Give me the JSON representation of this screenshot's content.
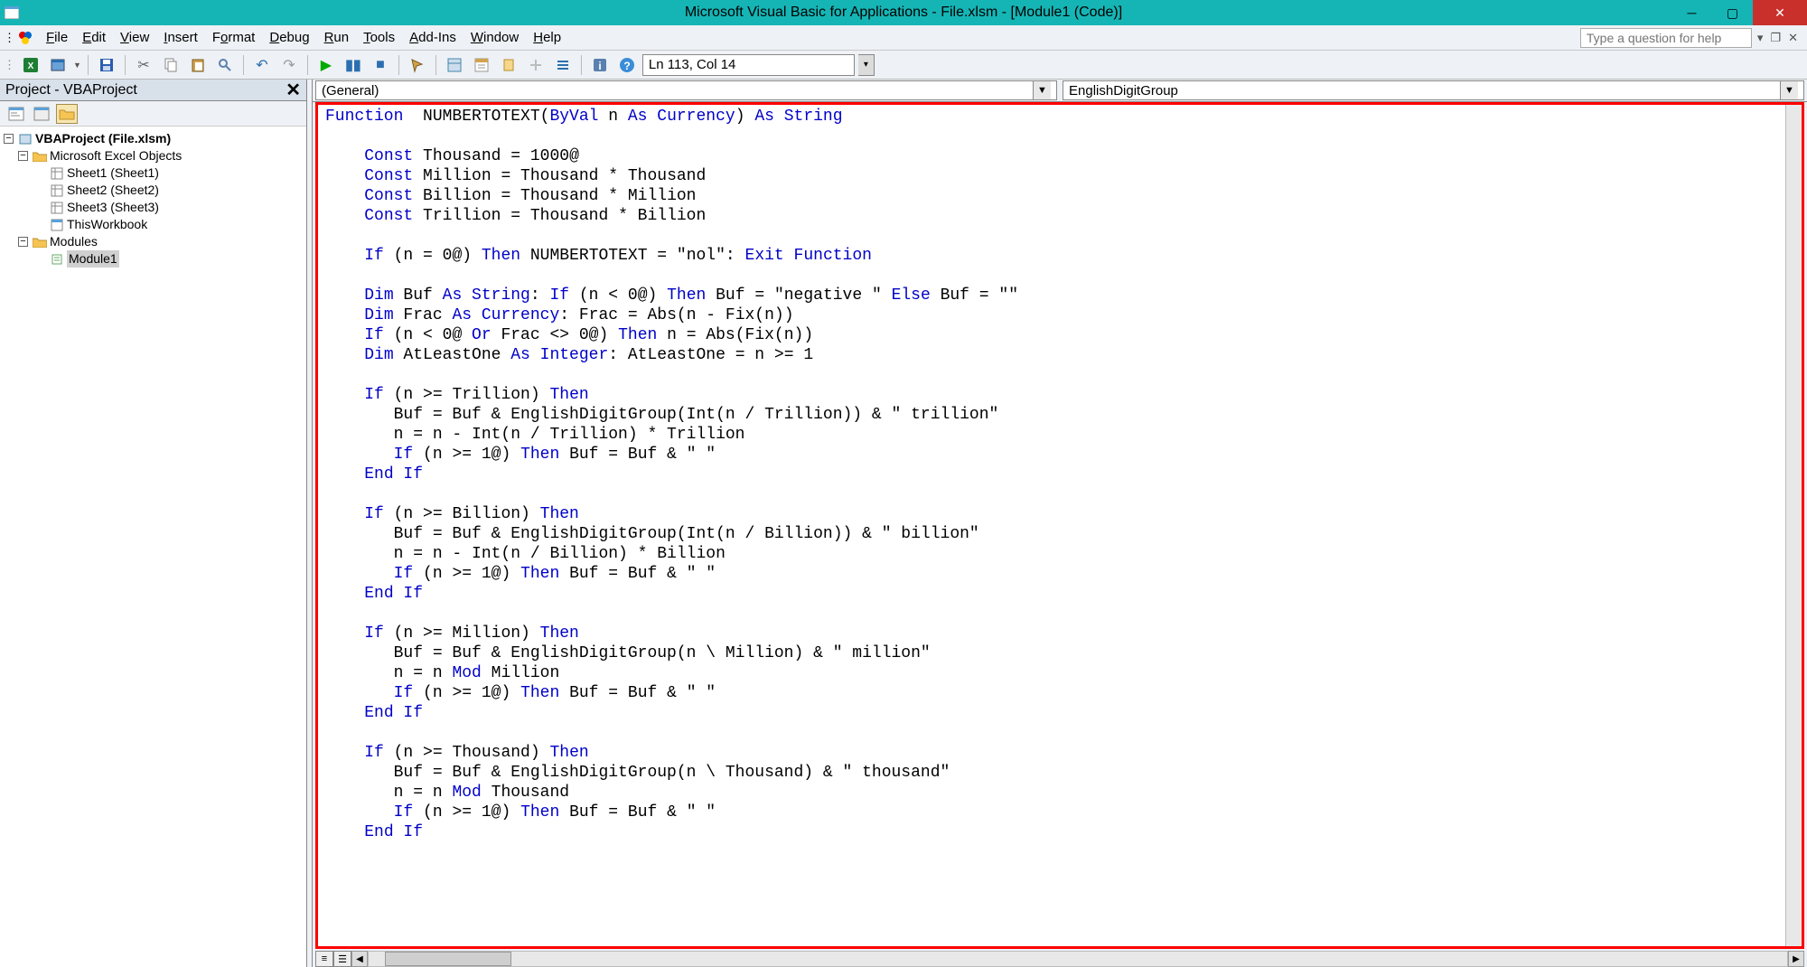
{
  "window": {
    "title": "Microsoft Visual Basic for Applications - File.xlsm - [Module1 (Code)]"
  },
  "menus": {
    "file": "File",
    "edit": "Edit",
    "view": "View",
    "insert": "Insert",
    "format": "Format",
    "debug": "Debug",
    "run": "Run",
    "tools": "Tools",
    "addins": "Add-Ins",
    "window": "Window",
    "help": "Help"
  },
  "help_search": {
    "placeholder": "Type a question for help"
  },
  "toolbar": {
    "position": "Ln 113, Col 14"
  },
  "project": {
    "title": "Project - VBAProject",
    "root": "VBAProject (File.xlsm)",
    "excel_objects": "Microsoft Excel Objects",
    "sheet1": "Sheet1 (Sheet1)",
    "sheet2": "Sheet2 (Sheet2)",
    "sheet3": "Sheet3 (Sheet3)",
    "thiswb": "ThisWorkbook",
    "modules": "Modules",
    "module1": "Module1"
  },
  "object_combo": "(General)",
  "proc_combo": "EnglishDigitGroup",
  "code": {
    "tokens": [
      [
        [
          "kw",
          "Function"
        ],
        [
          "",
          "  NUMBERTOTEXT("
        ],
        [
          "kw",
          "ByVal"
        ],
        [
          "",
          " n "
        ],
        [
          "kw",
          "As Currency"
        ],
        [
          "",
          ") "
        ],
        [
          "kw",
          "As String"
        ]
      ],
      [
        [
          "",
          ""
        ]
      ],
      [
        [
          "",
          "    "
        ],
        [
          "kw",
          "Const"
        ],
        [
          "",
          " Thousand = 1000@"
        ]
      ],
      [
        [
          "",
          "    "
        ],
        [
          "kw",
          "Const"
        ],
        [
          "",
          " Million = Thousand * Thousand"
        ]
      ],
      [
        [
          "",
          "    "
        ],
        [
          "kw",
          "Const"
        ],
        [
          "",
          " Billion = Thousand * Million"
        ]
      ],
      [
        [
          "",
          "    "
        ],
        [
          "kw",
          "Const"
        ],
        [
          "",
          " Trillion = Thousand * Billion"
        ]
      ],
      [
        [
          "",
          ""
        ]
      ],
      [
        [
          "",
          "    "
        ],
        [
          "kw",
          "If"
        ],
        [
          "",
          " (n = 0@) "
        ],
        [
          "kw",
          "Then"
        ],
        [
          "",
          " NUMBERTOTEXT = \"nol\": "
        ],
        [
          "kw",
          "Exit Function"
        ]
      ],
      [
        [
          "",
          ""
        ]
      ],
      [
        [
          "",
          "    "
        ],
        [
          "kw",
          "Dim"
        ],
        [
          "",
          " Buf "
        ],
        [
          "kw",
          "As String"
        ],
        [
          "",
          ": "
        ],
        [
          "kw",
          "If"
        ],
        [
          "",
          " (n < 0@) "
        ],
        [
          "kw",
          "Then"
        ],
        [
          "",
          " Buf = \"negative \" "
        ],
        [
          "kw",
          "Else"
        ],
        [
          "",
          " Buf = \"\""
        ]
      ],
      [
        [
          "",
          "    "
        ],
        [
          "kw",
          "Dim"
        ],
        [
          "",
          " Frac "
        ],
        [
          "kw",
          "As Currency"
        ],
        [
          "",
          ": Frac = Abs(n - Fix(n))"
        ]
      ],
      [
        [
          "",
          "    "
        ],
        [
          "kw",
          "If"
        ],
        [
          "",
          " (n < 0@ "
        ],
        [
          "kw",
          "Or"
        ],
        [
          "",
          " Frac <> 0@) "
        ],
        [
          "kw",
          "Then"
        ],
        [
          "",
          " n = Abs(Fix(n))"
        ]
      ],
      [
        [
          "",
          "    "
        ],
        [
          "kw",
          "Dim"
        ],
        [
          "",
          " AtLeastOne "
        ],
        [
          "kw",
          "As Integer"
        ],
        [
          "",
          ": AtLeastOne = n >= 1"
        ]
      ],
      [
        [
          "",
          ""
        ]
      ],
      [
        [
          "",
          "    "
        ],
        [
          "kw",
          "If"
        ],
        [
          "",
          " (n >= Trillion) "
        ],
        [
          "kw",
          "Then"
        ]
      ],
      [
        [
          "",
          "       Buf = Buf & EnglishDigitGroup(Int(n / Trillion)) & \" trillion\""
        ]
      ],
      [
        [
          "",
          "       n = n - Int(n / Trillion) * Trillion"
        ]
      ],
      [
        [
          "",
          "       "
        ],
        [
          "kw",
          "If"
        ],
        [
          "",
          " (n >= 1@) "
        ],
        [
          "kw",
          "Then"
        ],
        [
          "",
          " Buf = Buf & \" \""
        ]
      ],
      [
        [
          "",
          "    "
        ],
        [
          "kw",
          "End If"
        ]
      ],
      [
        [
          "",
          ""
        ]
      ],
      [
        [
          "",
          "    "
        ],
        [
          "kw",
          "If"
        ],
        [
          "",
          " (n >= Billion) "
        ],
        [
          "kw",
          "Then"
        ]
      ],
      [
        [
          "",
          "       Buf = Buf & EnglishDigitGroup(Int(n / Billion)) & \" billion\""
        ]
      ],
      [
        [
          "",
          "       n = n - Int(n / Billion) * Billion"
        ]
      ],
      [
        [
          "",
          "       "
        ],
        [
          "kw",
          "If"
        ],
        [
          "",
          " (n >= 1@) "
        ],
        [
          "kw",
          "Then"
        ],
        [
          "",
          " Buf = Buf & \" \""
        ]
      ],
      [
        [
          "",
          "    "
        ],
        [
          "kw",
          "End If"
        ]
      ],
      [
        [
          "",
          ""
        ]
      ],
      [
        [
          "",
          "    "
        ],
        [
          "kw",
          "If"
        ],
        [
          "",
          " (n >= Million) "
        ],
        [
          "kw",
          "Then"
        ]
      ],
      [
        [
          "",
          "       Buf = Buf & EnglishDigitGroup(n \\ Million) & \" million\""
        ]
      ],
      [
        [
          "",
          "       n = n "
        ],
        [
          "kw",
          "Mod"
        ],
        [
          "",
          " Million"
        ]
      ],
      [
        [
          "",
          "       "
        ],
        [
          "kw",
          "If"
        ],
        [
          "",
          " (n >= 1@) "
        ],
        [
          "kw",
          "Then"
        ],
        [
          "",
          " Buf = Buf & \" \""
        ]
      ],
      [
        [
          "",
          "    "
        ],
        [
          "kw",
          "End If"
        ]
      ],
      [
        [
          "",
          ""
        ]
      ],
      [
        [
          "",
          "    "
        ],
        [
          "kw",
          "If"
        ],
        [
          "",
          " (n >= Thousand) "
        ],
        [
          "kw",
          "Then"
        ]
      ],
      [
        [
          "",
          "       Buf = Buf & EnglishDigitGroup(n \\ Thousand) & \" thousand\""
        ]
      ],
      [
        [
          "",
          "       n = n "
        ],
        [
          "kw",
          "Mod"
        ],
        [
          "",
          " Thousand"
        ]
      ],
      [
        [
          "",
          "       "
        ],
        [
          "kw",
          "If"
        ],
        [
          "",
          " (n >= 1@) "
        ],
        [
          "kw",
          "Then"
        ],
        [
          "",
          " Buf = Buf & \" \""
        ]
      ],
      [
        [
          "",
          "    "
        ],
        [
          "kw",
          "End If"
        ]
      ],
      [
        [
          "",
          ""
        ]
      ]
    ]
  }
}
